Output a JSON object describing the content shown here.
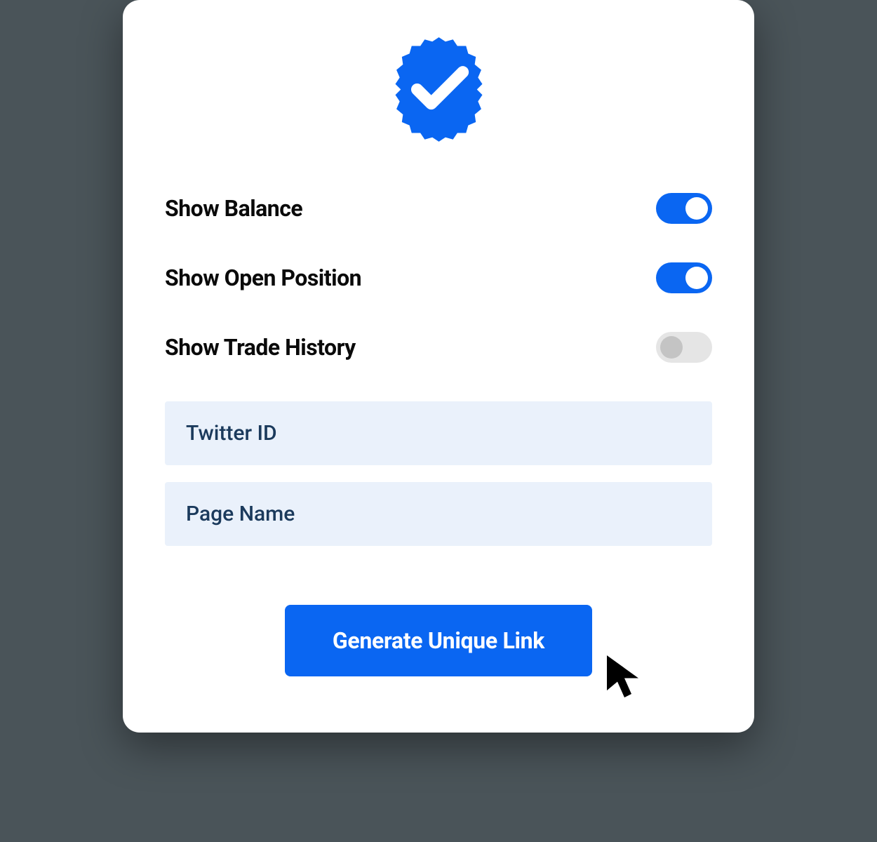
{
  "toggles": {
    "balance": {
      "label": "Show Balance",
      "enabled": true
    },
    "position": {
      "label": "Show Open Position",
      "enabled": true
    },
    "history": {
      "label": "Show Trade History",
      "enabled": false
    }
  },
  "inputs": {
    "twitter": {
      "placeholder": "Twitter ID",
      "value": ""
    },
    "page_name": {
      "placeholder": "Page Name",
      "value": ""
    }
  },
  "button": {
    "generate_label": "Generate Unique Link"
  },
  "colors": {
    "accent": "#0a66f2",
    "input_bg": "#eaf1fb",
    "toggle_off": "#e5e5e5"
  }
}
